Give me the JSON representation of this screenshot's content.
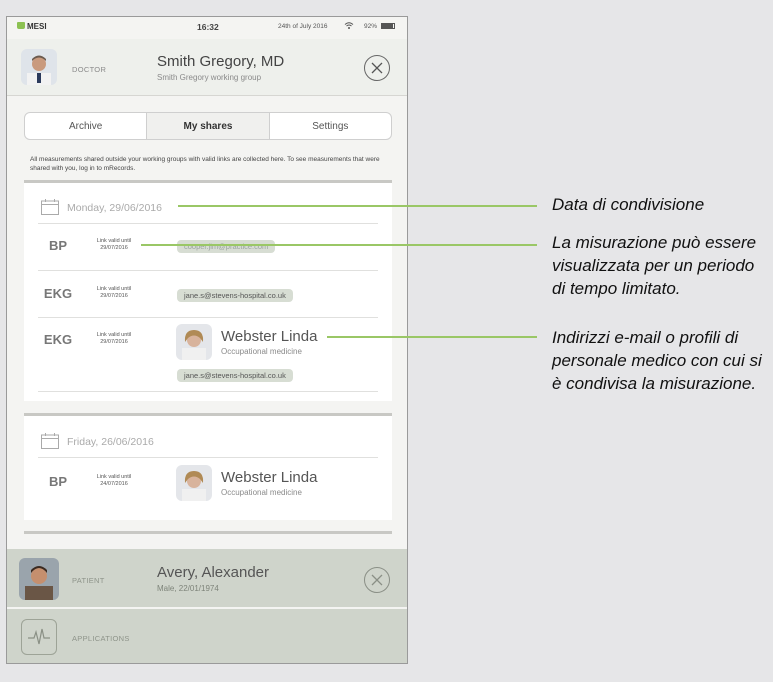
{
  "status_bar": {
    "logo": "MESI",
    "time": "16:32",
    "date": "24th of July 2016",
    "battery": "92%"
  },
  "doctor": {
    "role_label": "DOCTOR",
    "name": "Smith Gregory, MD",
    "group": "Smith Gregory working group"
  },
  "tabs": [
    {
      "label": "Archive"
    },
    {
      "label": "My shares"
    },
    {
      "label": "Settings"
    }
  ],
  "active_tab": "My shares",
  "info_text": "All measurements shared outside your working groups with valid links are collected here. To see measurements that were shared with you, log in to mRecords.",
  "groups": [
    {
      "date": "Monday, 29/06/2016",
      "items": [
        {
          "type": "BP",
          "valid_label": "Link valid until",
          "valid_date": "29/07/2016",
          "email": "cooper.jim@practice.com"
        },
        {
          "type": "EKG",
          "valid_label": "Link valid until",
          "valid_date": "29/07/2016",
          "email": "jane.s@stevens-hospital.co.uk"
        },
        {
          "type": "EKG",
          "valid_label": "Link valid until",
          "valid_date": "29/07/2016",
          "recipient_name": "Webster Linda",
          "recipient_spec": "Occupational medicine",
          "email": "jane.s@stevens-hospital.co.uk"
        }
      ]
    },
    {
      "date": "Friday, 26/06/2016",
      "items": [
        {
          "type": "BP",
          "valid_label": "Link valid until",
          "valid_date": "24/07/2016",
          "recipient_name": "Webster Linda",
          "recipient_spec": "Occupational medicine"
        }
      ]
    }
  ],
  "patient": {
    "role_label": "PATIENT",
    "name": "Avery, Alexander",
    "details": "Male, 22/01/1974"
  },
  "applications": {
    "label": "APPLICATIONS"
  },
  "annotations": [
    {
      "text": "Data di condivisione"
    },
    {
      "text": "La misurazione può essere visualizzata per un periodo di tempo limitato."
    },
    {
      "text": "Indirizzi e-mail o profili di personale medico con cui si è condivisa la misurazione."
    }
  ],
  "colors": {
    "accent_green": "#8cc152",
    "leader_green": "#9ac766",
    "chip": "#d7ddd3",
    "bottom_bar": "#cfd4cb"
  },
  "icons": [
    "wifi-icon",
    "battery-icon",
    "close-icon",
    "calendar-icon",
    "ekg-wave-icon"
  ]
}
